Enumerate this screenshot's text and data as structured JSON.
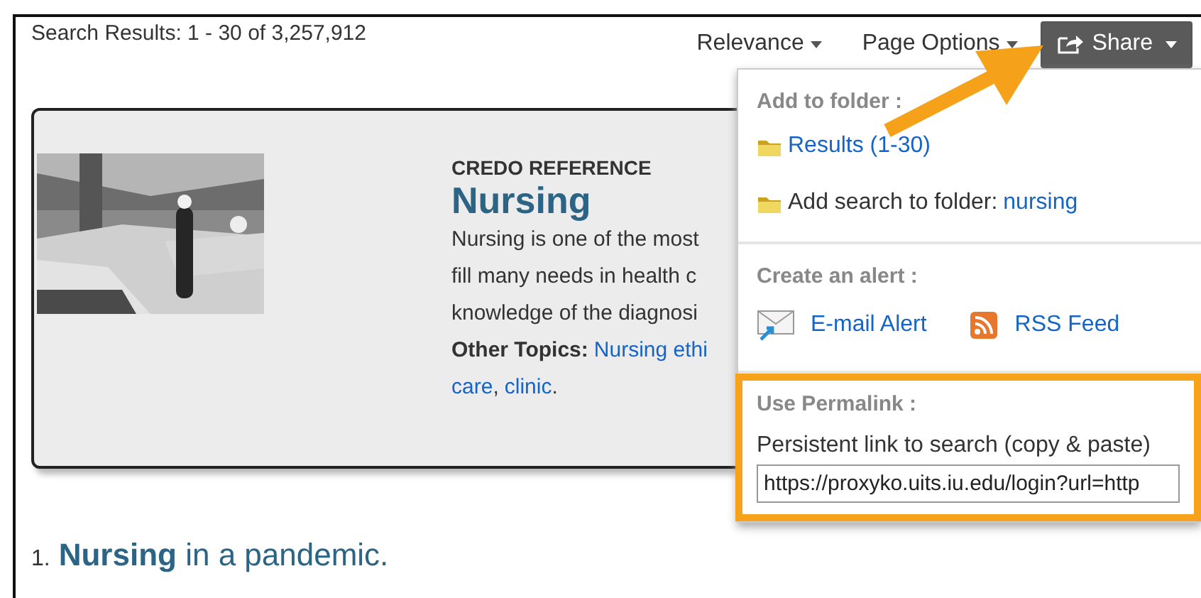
{
  "results_summary": "Search Results: 1 - 30 of 3,257,912",
  "toolbar": [
    {
      "kind": "dropdown",
      "label": "Relevance"
    },
    {
      "kind": "dropdown",
      "label": "Page Options"
    },
    {
      "kind": "share",
      "label": "Share",
      "expanded": true
    }
  ],
  "featured": {
    "source": "CREDO REFERENCE",
    "title": "Nursing",
    "lines": [
      "Nursing is one of the most",
      "fill many needs in health c",
      "knowledge of the diagnosi"
    ],
    "topics_label": "Other Topics:",
    "topic_lines": [
      {
        "links": [
          {
            "text": "Nursing ethi"
          }
        ]
      },
      {
        "links": [
          {
            "text": "care",
            "after": ","
          },
          {
            "text": "clinic",
            "after": "."
          }
        ]
      }
    ]
  },
  "share_menu": [
    {
      "heading": "Add to folder :",
      "highlighted": false,
      "items": [
        {
          "kind": "folder-link",
          "text": "Results (1-30)"
        },
        {
          "kind": "folder-text",
          "text": "Add search to folder:",
          "link": "nursing"
        }
      ]
    },
    {
      "heading": "Create an alert :",
      "highlighted": false,
      "items": [
        {
          "kind": "email",
          "text": "E-mail Alert"
        },
        {
          "kind": "rss",
          "text": "RSS Feed"
        }
      ]
    },
    {
      "heading": "Use Permalink :",
      "highlighted": true,
      "label": "Persistent link to search (copy & paste)",
      "value": "https://proxyko.uits.iu.edu/login?url=http"
    }
  ],
  "results": [
    {
      "number": "1.",
      "title": "**Nursing** in a pandemic."
    }
  ]
}
